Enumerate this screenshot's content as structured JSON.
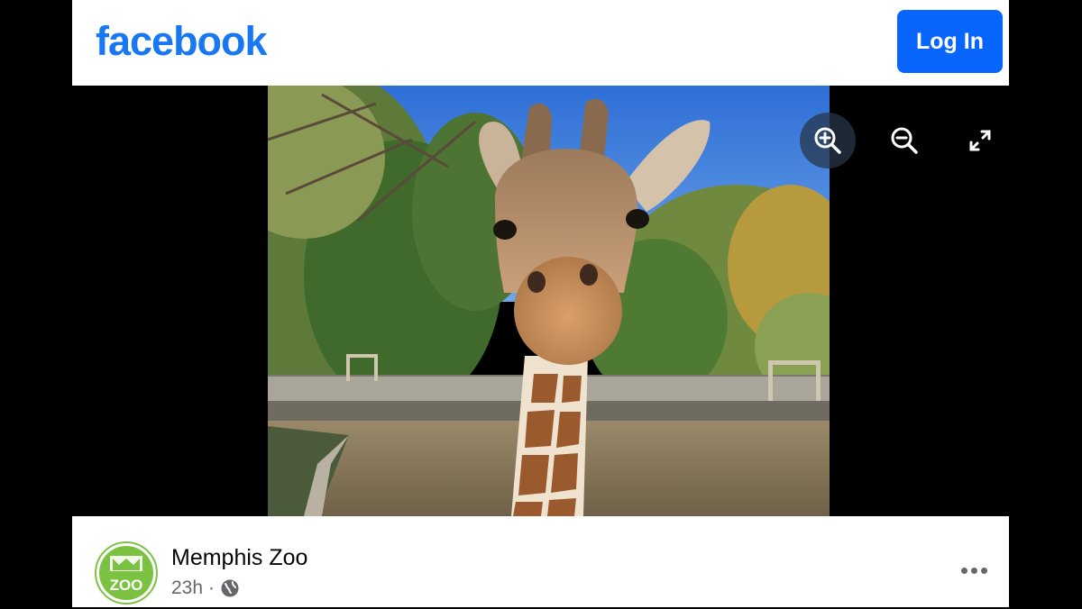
{
  "header": {
    "logo_text": "facebook",
    "login_label": "Log In",
    "brand_color": "#1877f2",
    "login_color": "#0866ff"
  },
  "viewer": {
    "controls": [
      {
        "name": "zoom-in",
        "icon": "zoom-in-icon",
        "active": true
      },
      {
        "name": "zoom-out",
        "icon": "zoom-out-icon",
        "active": false
      },
      {
        "name": "fullscreen",
        "icon": "expand-icon",
        "active": false
      }
    ]
  },
  "post": {
    "page_name": "Memphis Zoo",
    "timestamp": "23h",
    "separator": "·",
    "privacy_icon": "globe-icon",
    "avatar_text": "ZOO",
    "avatar_color": "#7cc242",
    "more_icon": "more-horizontal-icon"
  }
}
